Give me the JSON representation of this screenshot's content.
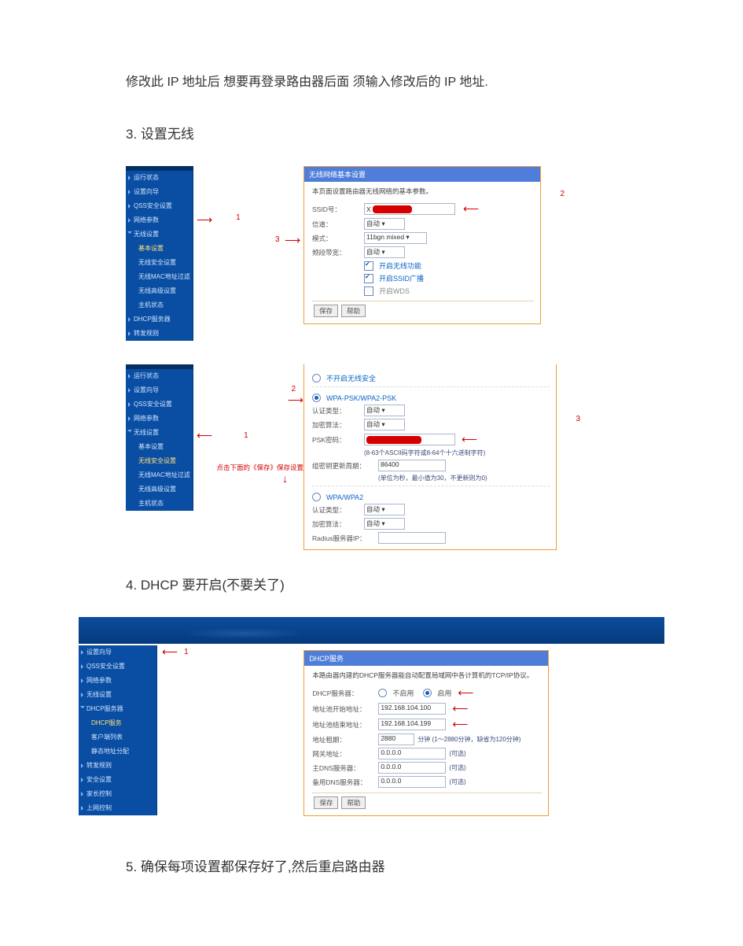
{
  "page": {
    "para1": "修改此 IP 地址后  想要再登录路由器后面  须输入修改后的 IP 地址.",
    "h3": "3. 设置无线",
    "h4": "4. DHCP 要开启(不要关了)",
    "h5": "5. 确保每项设置都保存好了,然后重启路由器"
  },
  "marks": {
    "n1": "1",
    "n2": "2",
    "n3": "3"
  },
  "sidebar_a": {
    "items": [
      {
        "label": "运行状态"
      },
      {
        "label": "设置向导"
      },
      {
        "label": "QSS安全设置"
      },
      {
        "label": "网络参数"
      },
      {
        "label": "无线设置",
        "open": true,
        "children": [
          {
            "label": "基本设置",
            "active": true
          },
          {
            "label": "无线安全设置"
          },
          {
            "label": "无线MAC地址过滤"
          },
          {
            "label": "无线高级设置"
          },
          {
            "label": "主机状态"
          }
        ]
      },
      {
        "label": "DHCP服务器"
      },
      {
        "label": "转发规则"
      }
    ]
  },
  "sidebar_b": {
    "items": [
      {
        "label": "运行状态"
      },
      {
        "label": "设置向导"
      },
      {
        "label": "QSS安全设置"
      },
      {
        "label": "网络参数"
      },
      {
        "label": "无线设置",
        "open": true,
        "children": [
          {
            "label": "基本设置"
          },
          {
            "label": "无线安全设置",
            "active": true
          },
          {
            "label": "无线MAC地址过滤"
          },
          {
            "label": "无线高级设置"
          },
          {
            "label": "主机状态"
          }
        ]
      }
    ]
  },
  "sidebar_c": {
    "items": [
      {
        "label": "设置向导"
      },
      {
        "label": "QSS安全设置"
      },
      {
        "label": "网络参数"
      },
      {
        "label": "无线设置"
      },
      {
        "label": "DHCP服务器",
        "open": true,
        "children": [
          {
            "label": "DHCP服务",
            "active": true
          },
          {
            "label": "客户端列表"
          },
          {
            "label": "静态地址分配"
          }
        ]
      },
      {
        "label": "转发规则"
      },
      {
        "label": "安全设置"
      },
      {
        "label": "家长控制"
      },
      {
        "label": "上网控制"
      }
    ]
  },
  "panel1": {
    "title": "无线网络基本设置",
    "sub": "本页面设置路由器无线网络的基本参数。",
    "ssid_label": "SSID号：",
    "ssid_value": "X",
    "chan_label": "信道：",
    "chan_value": "自动",
    "mode_label": "模式：",
    "mode_value": "11bgn mixed",
    "bw_label": "频段带宽：",
    "bw_value": "自动",
    "ck1": "开启无线功能",
    "ck2": "开启SSID广播",
    "ck3": "开启WDS",
    "save": "保存",
    "help": "帮助"
  },
  "panel2": {
    "opt_none": "不开启无线安全",
    "opt_wpa": "WPA-PSK/WPA2-PSK",
    "auth_label": "认证类型：",
    "auth_value": "自动",
    "enc_label": "加密算法：",
    "enc_value": "自动",
    "psk_label": "PSK密码：",
    "psk_value": "",
    "psk_hint": "(8-63个ASCII码字符或8-64个十六进制字符)",
    "upd_label": "组密钥更新周期：",
    "upd_value": "86400",
    "upd_hint": "(单位为秒，最小值为30，不更新则为0)",
    "save_hint": "点击下面的《保存》保存设置",
    "opt_wpa2": "WPA/WPA2",
    "auth2_label": "认证类型：",
    "auth2_value": "自动",
    "enc2_label": "加密算法：",
    "enc2_value": "自动",
    "rad_label": "Radius服务器IP："
  },
  "panel3": {
    "title": "DHCP服务",
    "sub": "本路由器内建的DHCP服务器能自动配置局域网中各计算机的TCP/IP协议。",
    "srv_label": "DHCP服务器：",
    "srv_off": "不启用",
    "srv_on": "启用",
    "start_label": "地址池开始地址：",
    "start_value": "192.168.104.100",
    "end_label": "地址池结束地址：",
    "end_value": "192.168.104.199",
    "lease_label": "地址租期：",
    "lease_value": "2880",
    "lease_unit": "分钟  (1～2880分钟，缺省为120分钟)",
    "gw_label": "网关地址：",
    "gw_value": "0.0.0.0",
    "opt": "(可选)",
    "dns1_label": "主DNS服务器：",
    "dns1_value": "0.0.0.0",
    "dns2_label": "备用DNS服务器：",
    "dns2_value": "0.0.0.0",
    "save": "保存",
    "help": "帮助"
  }
}
